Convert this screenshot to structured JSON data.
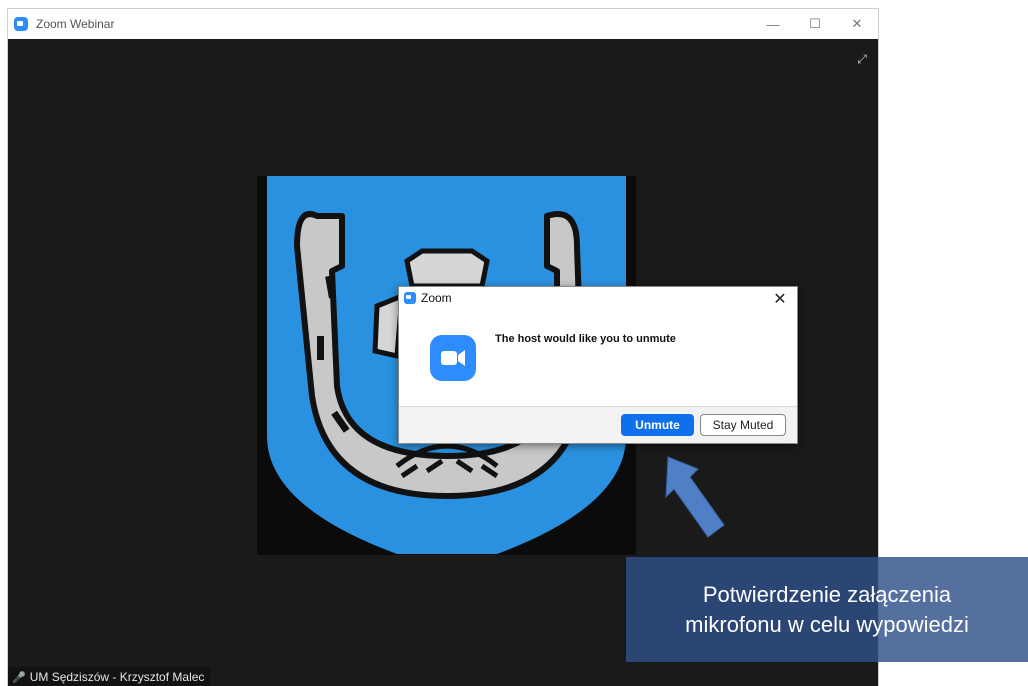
{
  "window": {
    "title": "Zoom Webinar",
    "minimize_glyph": "—",
    "maximize_glyph": "☐",
    "close_glyph": "✕",
    "app_icon": "zoom-camera-icon",
    "fullscreen_icon": "expand-arrows-icon",
    "fullscreen_glyph": "⤢"
  },
  "participant": {
    "name": "UM Sędziszów - Krzysztof Malec",
    "mic_icon": "mic-muted-icon",
    "mic_glyph": "🎤"
  },
  "dialog": {
    "title": "Zoom",
    "close_glyph": "✕",
    "message": "The host would like you to unmute",
    "unmute_label": "Unmute",
    "stay_muted_label": "Stay Muted"
  },
  "annotation": {
    "line1": "Potwierdzenie załączenia",
    "line2": "mikrofonu w celu wypowiedzi"
  },
  "colors": {
    "zoom_blue": "#2D8CFF",
    "unmute_blue": "#0E71EB",
    "coat_of_arms_blue": "#2A91E0",
    "horseshoe_grey": "#C8C8C8",
    "annotation_bg": "#2F508A",
    "arrow": "#4F7FC4"
  }
}
